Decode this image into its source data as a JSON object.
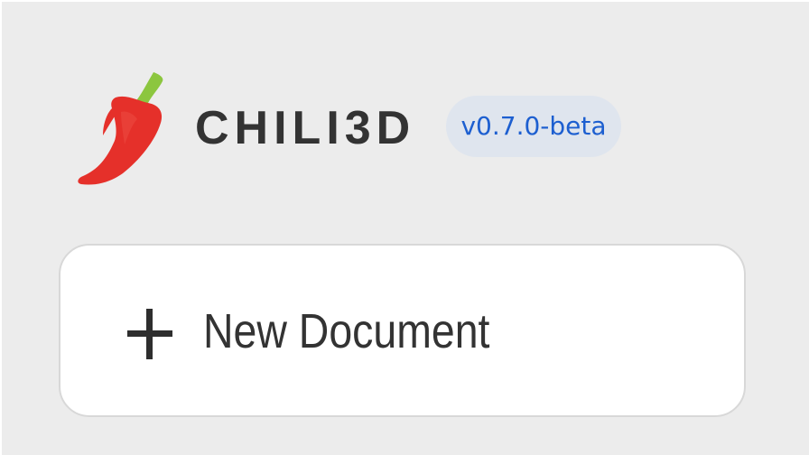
{
  "app": {
    "name": "CHILI3D",
    "version": "v0.7.0-beta",
    "logo_icon": "chili-pepper-icon"
  },
  "actions": {
    "new_document": {
      "label": "New Document",
      "icon": "plus-icon"
    }
  },
  "colors": {
    "background": "#ececec",
    "title_text": "#333333",
    "badge_background": "#dfe5ee",
    "badge_text": "#1d5fd0",
    "pepper_red": "#e5302a",
    "pepper_stem": "#8cc63f",
    "button_background": "#ffffff",
    "button_border": "#d8d8d8"
  }
}
